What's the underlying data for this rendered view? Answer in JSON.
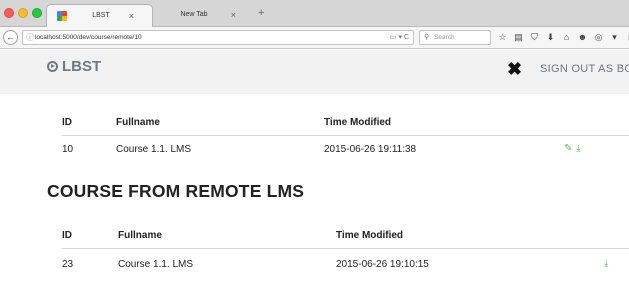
{
  "browser": {
    "tabs": [
      {
        "title": "LBST",
        "close": "×"
      },
      {
        "title": "New Tab",
        "close": "×"
      }
    ],
    "new_tab": "+",
    "back": "←",
    "url": "localhost:5000/dev/course/remote/10",
    "url_tools": "▭ ▾ C",
    "search_placeholder": "Search",
    "toolbar_icons": [
      "☆",
      "▤",
      "⛉",
      "⬇",
      "⌂",
      "☻",
      "◎",
      "▾",
      "▯",
      "▦"
    ]
  },
  "header": {
    "brand": "LBST",
    "tools_icon": "✖",
    "signout_label": "SIGN OUT AS BOB"
  },
  "local_table": {
    "columns": [
      "ID",
      "Fullname",
      "Time Modified"
    ],
    "rows": [
      {
        "id": "10",
        "fullname": "Course 1.1. LMS",
        "time": "2015-06-26 19:11:38",
        "edit_icon": "✎",
        "download_icon": "⤓"
      }
    ]
  },
  "remote_section": {
    "title": "COURSE FROM REMOTE LMS"
  },
  "remote_table": {
    "columns": [
      "ID",
      "Fullname",
      "Time Modified"
    ],
    "rows": [
      {
        "id": "23",
        "fullname": "Course 1.1. LMS",
        "time": "2015-06-26 19:10:15",
        "download_icon": "⤓"
      }
    ]
  },
  "colors": {
    "header_bg": "#f2f2f2",
    "brand": "#6b7a85",
    "action_green": "#5cb85c"
  }
}
